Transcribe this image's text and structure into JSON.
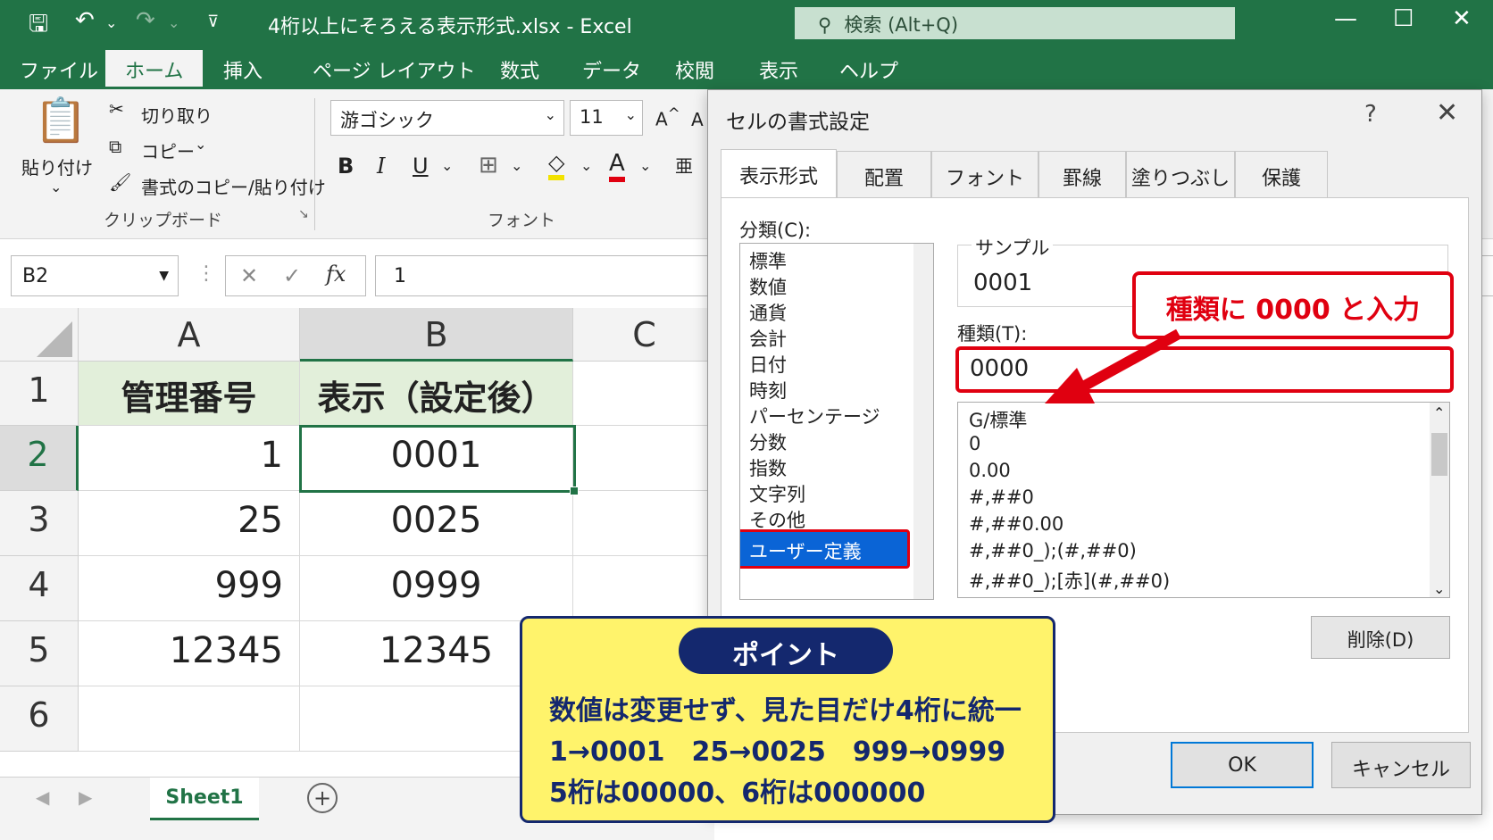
{
  "window": {
    "title": "4桁以上にそろえる表示形式.xlsx  -  Excel",
    "search_placeholder": "検索 (Alt+Q)",
    "accent": "#217346"
  },
  "ribbon_tabs": [
    "ファイル",
    "ホーム",
    "挿入",
    "ページ レイアウト",
    "数式",
    "データ",
    "校閲",
    "表示",
    "ヘルプ"
  ],
  "ribbon": {
    "paste_label": "貼り付け",
    "cut_label": "切り取り",
    "copy_label": "コピー",
    "format_painter_label": "書式のコピー/貼り付け",
    "clipboard_group": "クリップボード",
    "font_name": "游ゴシック",
    "font_size": "11",
    "font_group": "フォント",
    "bold": "B",
    "italic": "I",
    "underline": "U"
  },
  "formula_bar": {
    "name_box": "B2",
    "fx": "fx",
    "value": "1"
  },
  "grid": {
    "columns": [
      "A",
      "B",
      "C"
    ],
    "rows": [
      "1",
      "2",
      "3",
      "4",
      "5",
      "6"
    ],
    "header": [
      "管理番号",
      "表示（設定後）"
    ],
    "data": [
      [
        "1",
        "0001"
      ],
      [
        "25",
        "0025"
      ],
      [
        "999",
        "0999"
      ],
      [
        "12345",
        "12345"
      ]
    ]
  },
  "sheet_tab": "Sheet1",
  "dialog": {
    "title": "セルの書式設定",
    "help": "?",
    "close": "✕",
    "tabs": [
      "表示形式",
      "配置",
      "フォント",
      "罫線",
      "塗りつぶし",
      "保護"
    ],
    "category_label": "分類(C):",
    "categories": [
      "標準",
      "数値",
      "通貨",
      "会計",
      "日付",
      "時刻",
      "パーセンテージ",
      "分数",
      "指数",
      "文字列",
      "その他"
    ],
    "selected_category": "ユーザー定義",
    "sample_label": "サンプル",
    "sample_value": "0001",
    "type_label": "種類(T):",
    "type_value": "0000",
    "formats": [
      "G/標準",
      "0",
      "0.00",
      "#,##0",
      "#,##0.00",
      "#,##0_);(#,##0)",
      "#,##0_);[赤](#,##0)"
    ],
    "delete_button": "削除(D)",
    "ok_button": "OK",
    "cancel_button": "キャンセル"
  },
  "callouts": {
    "type_hint": "種類に 0000 と入力",
    "point_title": "ポイント",
    "point_lines": [
      "数値は変更せず、見た目だけ4桁に統一",
      "1→0001　25→0025　999→0999",
      "5桁は00000、6桁は000000"
    ],
    "highlight_color": "#e00010",
    "point_bg": "#fff36b",
    "point_navy": "#14286e"
  }
}
